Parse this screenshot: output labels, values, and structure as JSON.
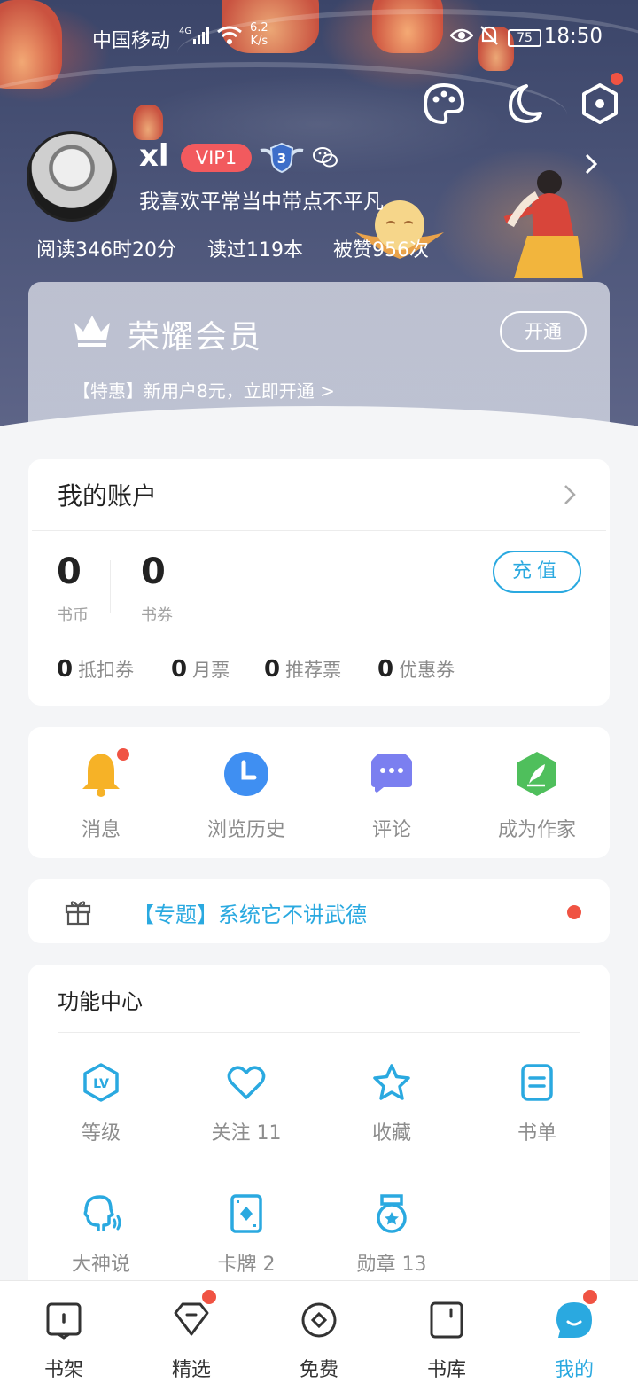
{
  "status_bar": {
    "carrier": "中国移动",
    "network": "4G",
    "speed_value": "6.2",
    "speed_unit": "K/s",
    "battery": "75",
    "time": "18:50"
  },
  "header_icons": [
    "palette-icon",
    "moon-icon",
    "settings-hex-icon"
  ],
  "profile": {
    "username": "xl",
    "vip_label": "VIP1",
    "level": "3",
    "signature": "我喜欢平常当中带点不平凡",
    "stats": {
      "reading_time": "阅读346时20分",
      "books_read": "读过119本",
      "likes": "被赞956次"
    }
  },
  "member": {
    "title": "荣耀会员",
    "open_label": "开通",
    "promo": "【特惠】新用户8元，立即开通 >"
  },
  "account": {
    "title": "我的账户",
    "coins_value": "0",
    "coins_label": "书币",
    "tickets_value": "0",
    "tickets_label": "书券",
    "recharge_label": "充值",
    "vouchers": [
      {
        "value": "0",
        "label": "抵扣券"
      },
      {
        "value": "0",
        "label": "月票"
      },
      {
        "value": "0",
        "label": "推荐票"
      },
      {
        "value": "0",
        "label": "优惠券"
      }
    ]
  },
  "quick_actions": [
    {
      "label": "消息",
      "icon": "bell-icon"
    },
    {
      "label": "浏览历史",
      "icon": "clock-icon"
    },
    {
      "label": "评论",
      "icon": "comment-icon"
    },
    {
      "label": "成为作家",
      "icon": "feather-icon"
    }
  ],
  "topic": {
    "text": "【专题】系统它不讲武德"
  },
  "function_center": {
    "title": "功能中心",
    "items": [
      {
        "label": "等级",
        "icon": "level-icon"
      },
      {
        "label": "关注 11",
        "icon": "heart-icon"
      },
      {
        "label": "收藏",
        "icon": "star-icon"
      },
      {
        "label": "书单",
        "icon": "booklist-icon"
      },
      {
        "label": "大神说",
        "icon": "speaking-head-icon"
      },
      {
        "label": "卡牌 2",
        "icon": "card-icon"
      },
      {
        "label": "勋章 13",
        "icon": "medal-icon"
      }
    ]
  },
  "bottom_nav": [
    {
      "label": "书架",
      "icon": "bookshelf-icon"
    },
    {
      "label": "精选",
      "icon": "featured-icon"
    },
    {
      "label": "免费",
      "icon": "free-icon"
    },
    {
      "label": "书库",
      "icon": "library-icon"
    },
    {
      "label": "我的",
      "icon": "profile-icon"
    }
  ],
  "colors": {
    "accent": "#2aa9e0",
    "vip_red": "#f25a5e",
    "badge_red": "#f05343",
    "header_bg": "#4b5478"
  }
}
